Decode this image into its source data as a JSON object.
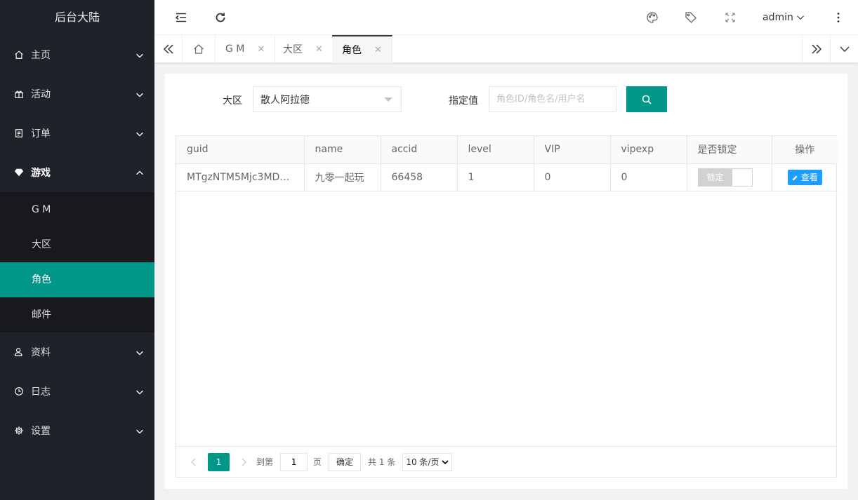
{
  "app": {
    "title": "后台大陆"
  },
  "sidebar": {
    "items": [
      {
        "label": "主页"
      },
      {
        "label": "活动"
      },
      {
        "label": "订单"
      },
      {
        "label": "游戏"
      },
      {
        "label": "资料"
      },
      {
        "label": "日志"
      },
      {
        "label": "设置"
      }
    ],
    "game_sub": [
      {
        "label": "G M"
      },
      {
        "label": "大区"
      },
      {
        "label": "角色"
      },
      {
        "label": "邮件"
      }
    ]
  },
  "header": {
    "user": "admin"
  },
  "tabs": [
    {
      "label": "G M"
    },
    {
      "label": "大区"
    },
    {
      "label": "角色"
    }
  ],
  "form": {
    "region_label": "大区",
    "region_value": "散人阿拉德",
    "value_label": "指定值",
    "value_placeholder": "角色ID/角色名/用户名"
  },
  "table": {
    "columns": [
      "guid",
      "name",
      "accid",
      "level",
      "VIP",
      "vipexp",
      "是否锁定",
      "操作"
    ],
    "rows": [
      {
        "guid": "MTgzNTM5Mjc3MDA...",
        "name": "九零一起玩",
        "accid": "66458",
        "level": "1",
        "vip": "0",
        "vipexp": "0",
        "lock": "锁定",
        "action": "查看"
      }
    ]
  },
  "pager": {
    "current": "1",
    "goto_label": "到第",
    "goto_value": "1",
    "page_label": "页",
    "confirm": "确定",
    "total": "共 1 条",
    "page_size": "10 条/页"
  },
  "colors": {
    "accent": "#009688",
    "sidebar_bg": "#20222a",
    "info_btn": "#1e9fff"
  }
}
